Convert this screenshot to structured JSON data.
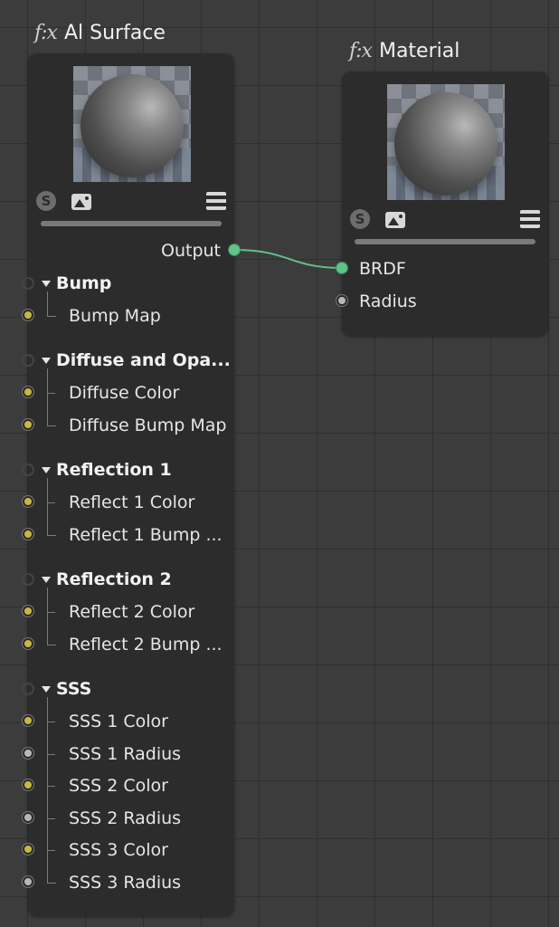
{
  "left_node": {
    "fx_label": "f:x",
    "title": "Al Surface",
    "output_label": "Output",
    "groups": [
      {
        "label": "Bump",
        "items": [
          {
            "label": "Bump Map",
            "port": "yellow"
          }
        ]
      },
      {
        "label": "Diffuse and Opa...",
        "items": [
          {
            "label": "Diffuse Color",
            "port": "yellow"
          },
          {
            "label": "Diffuse Bump Map",
            "port": "yellow"
          }
        ]
      },
      {
        "label": "Reflection 1",
        "items": [
          {
            "label": "Reflect 1 Color",
            "port": "yellow"
          },
          {
            "label": "Reflect 1 Bump ...",
            "port": "yellow"
          }
        ]
      },
      {
        "label": "Reflection 2",
        "items": [
          {
            "label": "Reflect 2 Color",
            "port": "yellow"
          },
          {
            "label": "Reflect 2 Bump ...",
            "port": "yellow"
          }
        ]
      },
      {
        "label": "SSS",
        "items": [
          {
            "label": "SSS 1 Color",
            "port": "yellow"
          },
          {
            "label": "SSS 1 Radius",
            "port": "gray"
          },
          {
            "label": "SSS 2 Color",
            "port": "yellow"
          },
          {
            "label": "SSS 2 Radius",
            "port": "gray"
          },
          {
            "label": "SSS 3 Color",
            "port": "yellow"
          },
          {
            "label": "SSS 3 Radius",
            "port": "gray"
          }
        ]
      }
    ],
    "s_icon": "S"
  },
  "right_node": {
    "fx_label": "f:x",
    "title": "Material",
    "inputs": [
      {
        "label": "BRDF",
        "port": "green"
      },
      {
        "label": "Radius",
        "port": "gray"
      }
    ],
    "s_icon": "S"
  },
  "colors": {
    "background": "#3c3c3c",
    "node": "#2c2c2c",
    "connection": "#5fc38a",
    "port_color": "#c9b740",
    "port_float": "#b8b8b8"
  }
}
